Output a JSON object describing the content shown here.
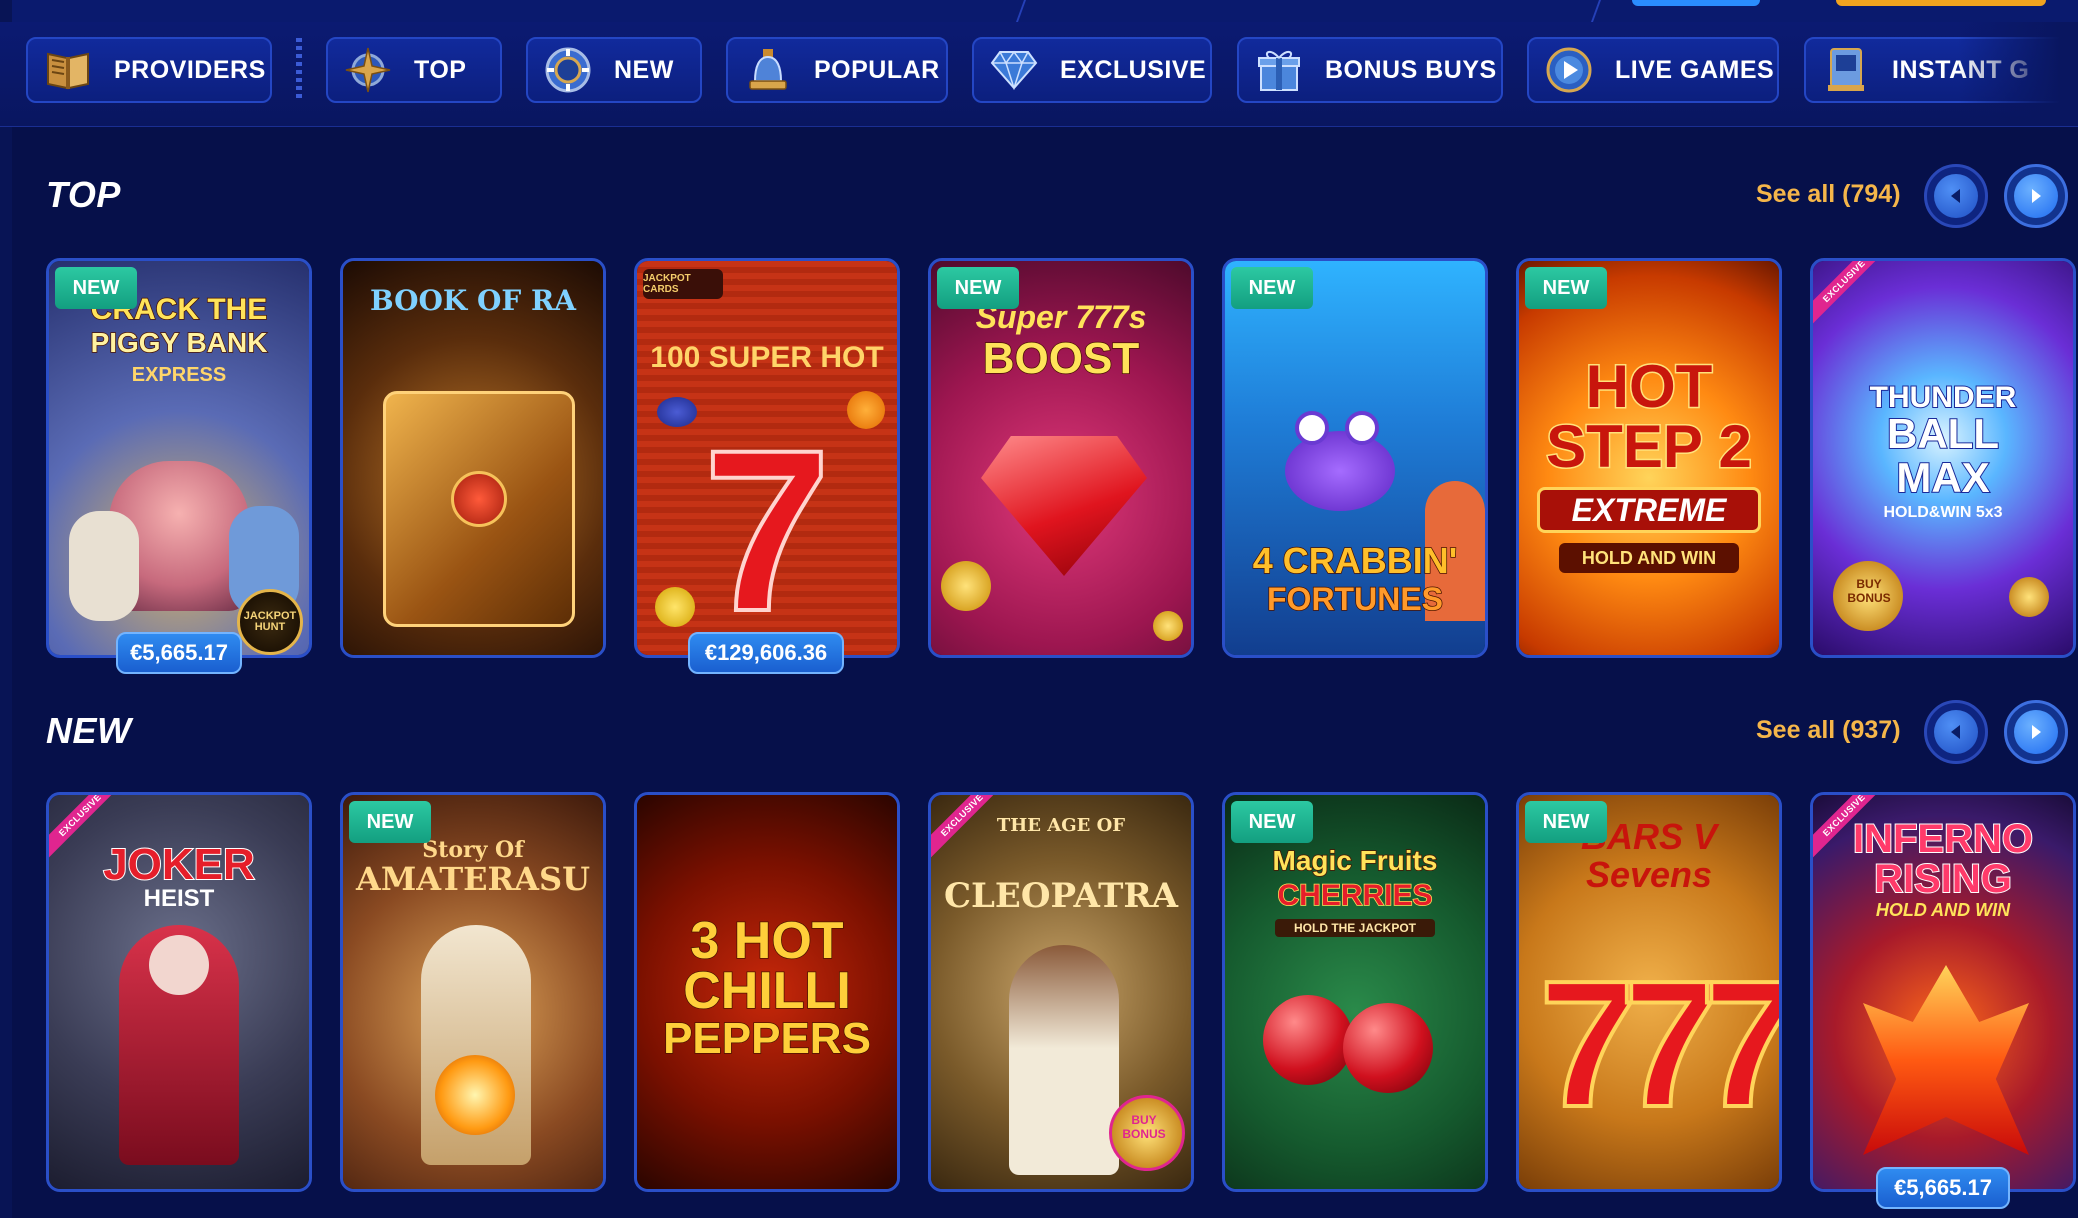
{
  "nav": {
    "items": [
      {
        "label": "PROVIDERS",
        "icon": "book-icon"
      },
      {
        "label": "TOP",
        "icon": "compass-star-icon"
      },
      {
        "label": "NEW",
        "icon": "chip-icon"
      },
      {
        "label": "POPULAR",
        "icon": "bell-icon"
      },
      {
        "label": "EXCLUSIVE",
        "icon": "diamond-icon"
      },
      {
        "label": "BONUS BUYS",
        "icon": "gift-icon"
      },
      {
        "label": "LIVE GAMES",
        "icon": "play-disc-icon"
      },
      {
        "label": "INSTANT G",
        "icon": "instant-machine-icon"
      }
    ]
  },
  "sections": {
    "top": {
      "title": "TOP",
      "see_all": "See all (794)",
      "games": [
        {
          "title_lines": [
            "CRACK THE",
            "PIGGY BANK",
            "EXPRESS"
          ],
          "badge": "NEW",
          "jackpot": "€5,665.17",
          "extra": "JACKPOT HUNT"
        },
        {
          "title_lines": [
            "BOOK OF RA"
          ]
        },
        {
          "title_lines": [
            "100 SUPER HOT"
          ],
          "extra": "JACKPOT CARDS",
          "jackpot": "€129,606.36"
        },
        {
          "title_lines": [
            "Super 777s",
            "BOOST"
          ],
          "badge": "NEW"
        },
        {
          "title_lines": [
            "4 CRABBIN'",
            "FORTUNES"
          ],
          "badge": "NEW"
        },
        {
          "title_lines": [
            "HOT STEP 2",
            "EXTREME",
            "HOLD AND WIN"
          ],
          "badge": "NEW"
        },
        {
          "title_lines": [
            "THUNDER",
            "BALL",
            "MAX",
            "HOLD&WIN 5x3"
          ],
          "badge": "EXCLUSIVE",
          "extra": "BUY BONUS"
        }
      ]
    },
    "new": {
      "title": "NEW",
      "see_all": "See all (937)",
      "games": [
        {
          "title_lines": [
            "JOKER",
            "HEIST"
          ],
          "badge": "EXCLUSIVE"
        },
        {
          "title_lines": [
            "Story Of",
            "AMATERASU"
          ],
          "badge": "NEW"
        },
        {
          "title_lines": [
            "3 HOT",
            "CHILLI",
            "PEPPERS"
          ]
        },
        {
          "title_lines": [
            "THE AGE OF",
            "CLEOPATRA"
          ],
          "badge": "EXCLUSIVE",
          "extra": "BUY BONUS"
        },
        {
          "title_lines": [
            "Magic Fruits",
            "CHERRIES",
            "HOLD THE JACKPOT"
          ],
          "badge": "NEW"
        },
        {
          "title_lines": [
            "BARS V",
            "Sevens"
          ],
          "badge": "NEW"
        },
        {
          "title_lines": [
            "INFERNO",
            "RISING",
            "HOLD AND WIN"
          ],
          "badge": "EXCLUSIVE",
          "jackpot": "€5,665.17"
        }
      ]
    }
  },
  "colors": {
    "background": "#06104a",
    "nav_button": "#112a9c",
    "accent_link": "#f5b64a",
    "badge_new": "#20b896",
    "badge_exclusive": "#e0258f",
    "jackpot": "#2a7ff0"
  }
}
